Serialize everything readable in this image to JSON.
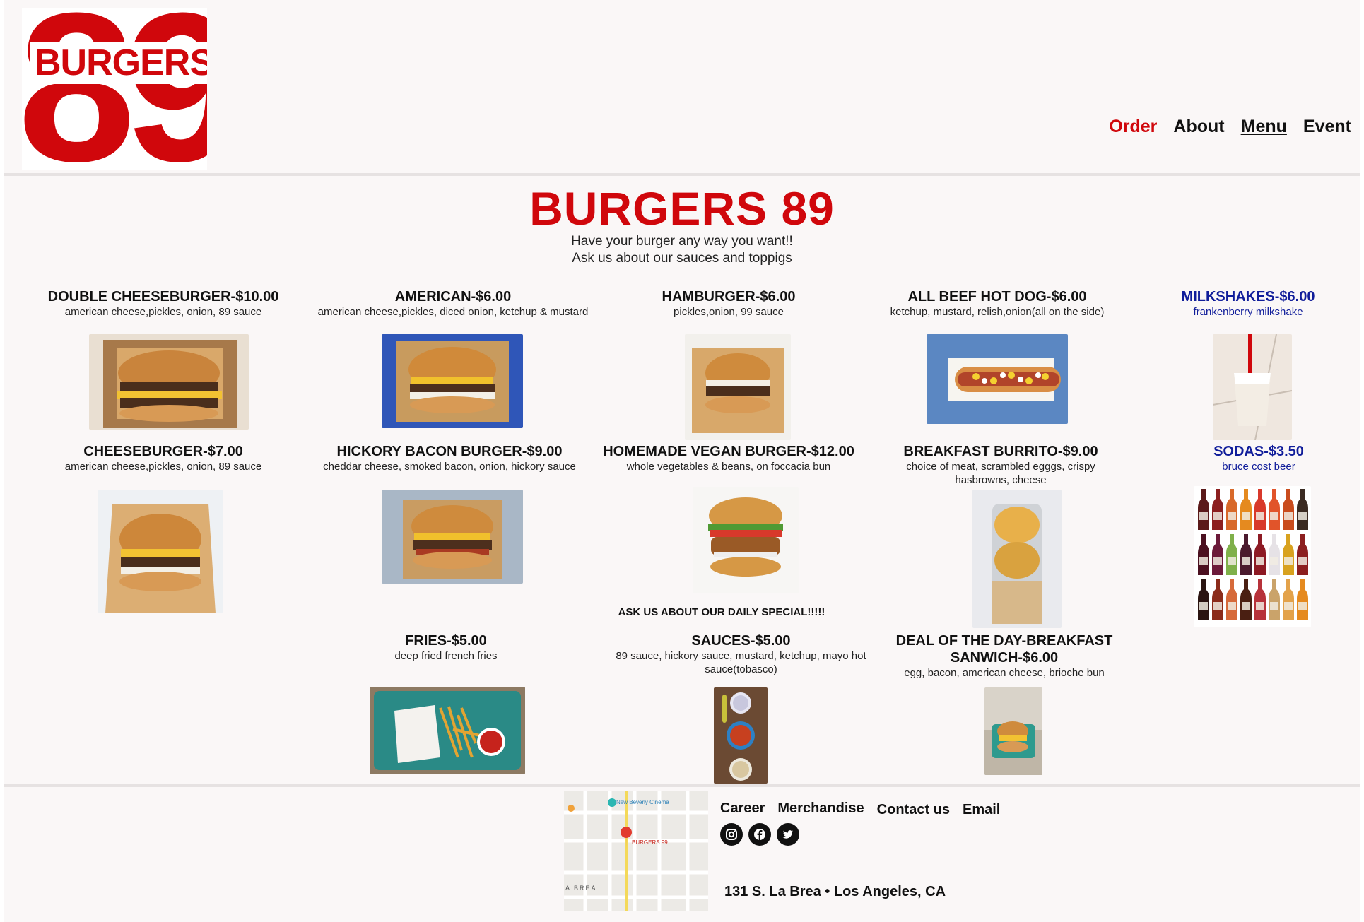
{
  "brand": {
    "logo_word": "BURGERS",
    "logo_number": "89",
    "accent": "#d0070c",
    "blue": "#101d9a"
  },
  "nav": {
    "order": "Order",
    "about": "About",
    "menu": "Menu",
    "event": "Event"
  },
  "hero": {
    "title": "BURGERS 89",
    "line1": "Have your burger any way you want!!",
    "line2": "Ask us about our sauces and toppigs"
  },
  "items": {
    "double_cheeseburger": {
      "title": "DOUBLE CHEESEBURGER-$10.00",
      "desc": "american cheese,pickles, onion, 89 sauce"
    },
    "american": {
      "title": "AMERICAN-$6.00",
      "desc": "american cheese,pickles, diced onion, ketchup & mustard"
    },
    "hamburger": {
      "title": "HAMBURGER-$6.00",
      "desc": "pickles,onion, 99 sauce"
    },
    "hot_dog": {
      "title": "ALL BEEF HOT DOG-$6.00",
      "desc": "ketchup, mustard, relish,onion(all on the side)"
    },
    "milkshakes": {
      "title": "MILKSHAKES-$6.00",
      "desc": "frankenberry milkshake"
    },
    "cheeseburger": {
      "title": "CHEESEBURGER-$7.00",
      "desc": "american cheese,pickles, onion, 89 sauce"
    },
    "hickory": {
      "title": "HICKORY BACON BURGER-$9.00",
      "desc": "cheddar cheese, smoked bacon, onion, hickory sauce"
    },
    "vegan": {
      "title": "HOMEMADE VEGAN BURGER-$12.00",
      "desc": "whole vegetables & beans, on foccacia bun"
    },
    "burrito": {
      "title": "BREAKFAST BURRITO-$9.00",
      "desc": "choice of meat, scrambled egggs, crispy hasbrowns, cheese"
    },
    "sodas": {
      "title": "SODAS-$3.50",
      "desc": "bruce cost beer"
    },
    "fries": {
      "title": "FRIES-$5.00",
      "desc": "deep fried french fries"
    },
    "sauces": {
      "title": "SAUCES-$5.00",
      "desc": "89 sauce, hickory sauce, mustard, ketchup, mayo hot sauce(tobasco)"
    },
    "deal": {
      "title": "DEAL OF THE DAY-BREAKFAST SANWICH-$6.00",
      "desc": "egg, bacon, american cheese, brioche bun"
    }
  },
  "special": "ASK US ABOUT OUR DAILY SPECIAL!!!!!",
  "map": {
    "label_cinema": "New Beverly Cinema",
    "label_pin": "BURGERS 99",
    "label_area": "A BREA"
  },
  "footer": {
    "career": "Career",
    "merchandise": "Merchandise",
    "contact": "Contact us",
    "email": "Email",
    "address": "131 S. La Brea • Los Angeles, CA",
    "social": [
      "instagram-icon",
      "facebook-icon",
      "twitter-icon"
    ]
  }
}
